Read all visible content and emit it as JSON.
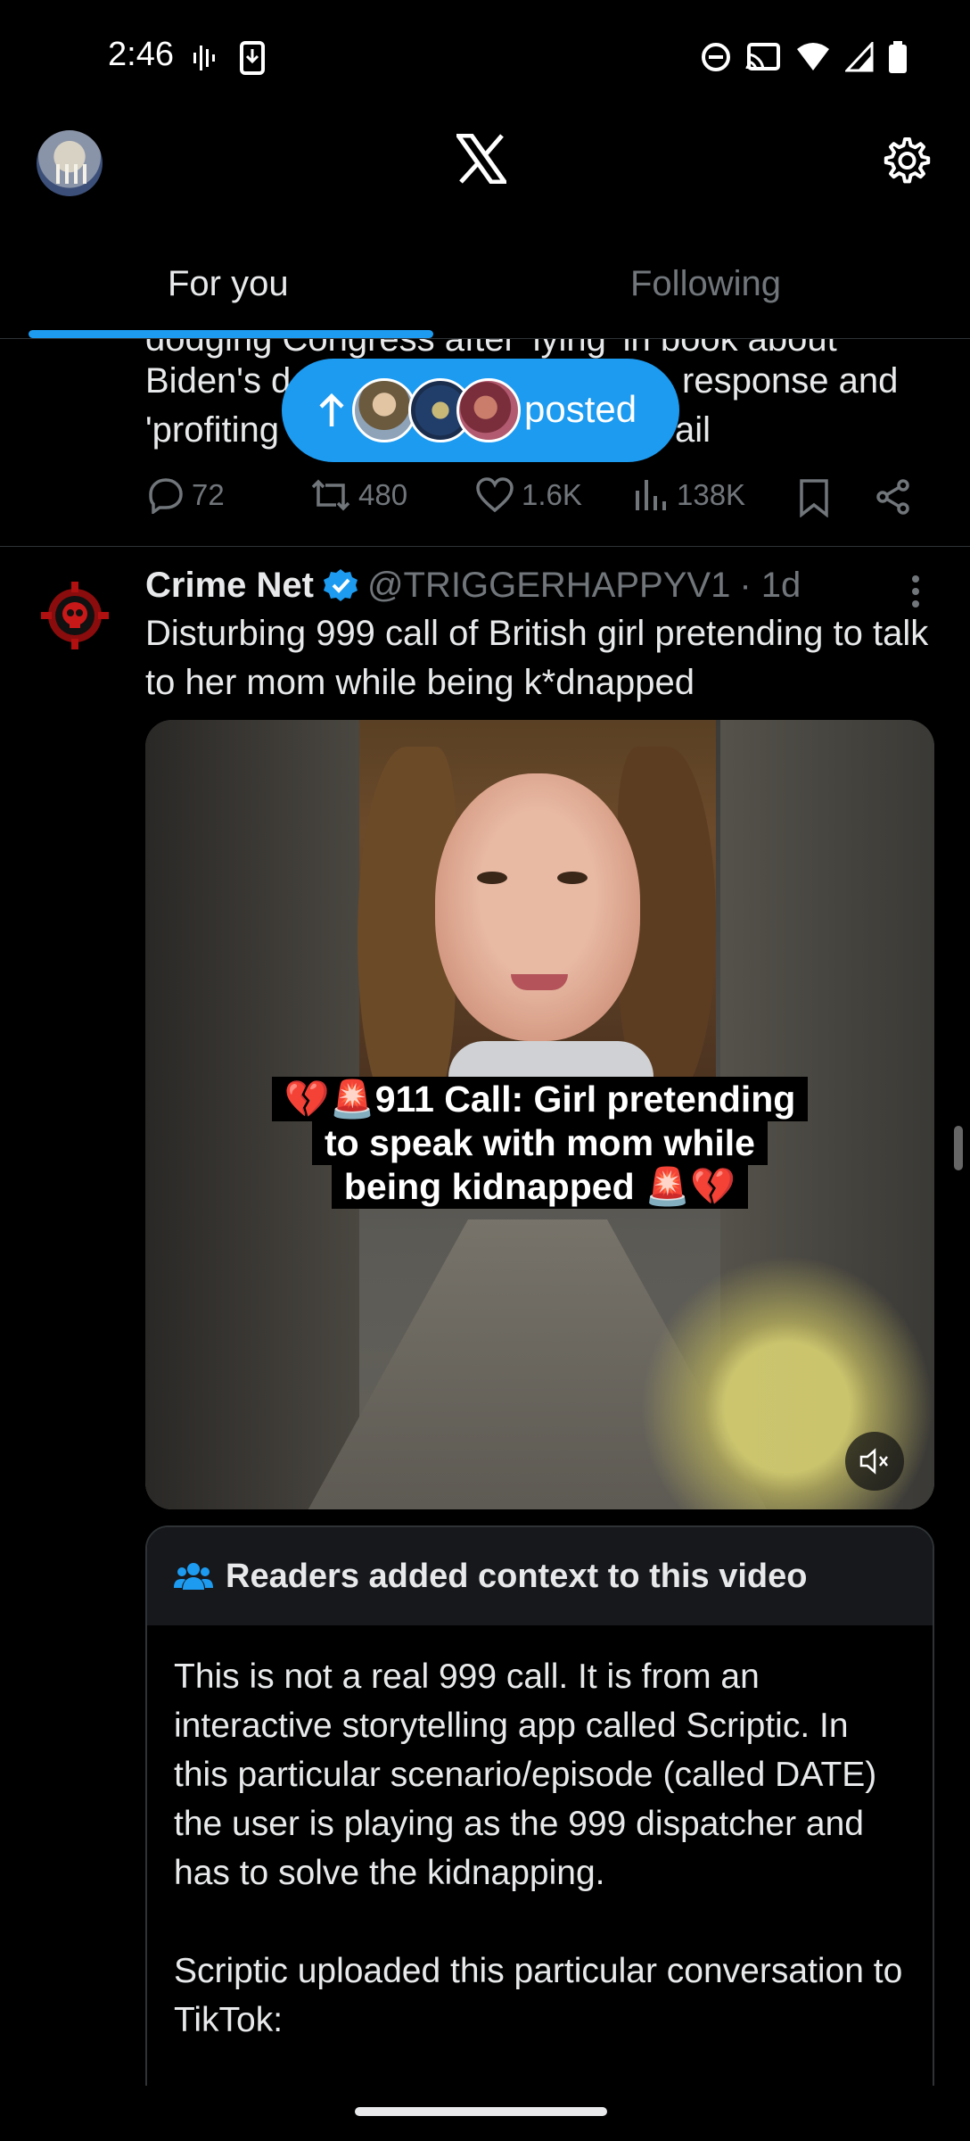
{
  "status_bar": {
    "time": "2:46"
  },
  "header": {
    "logo": "x-logo-icon"
  },
  "tabs": [
    {
      "label": "For you",
      "active": true
    },
    {
      "label": "Following",
      "active": false
    }
  ],
  "previous_tweet": {
    "text_line_1": "dodging Congress after 'lying' in book about",
    "text_line_2_left": "Biden's d",
    "text_line_2_right": "response and",
    "text_line_3_left": "'profiting",
    "text_line_3_right": "ail",
    "replies": "72",
    "reposts": "480",
    "likes": "1.6K",
    "views": "138K"
  },
  "new_posts_pill": {
    "label": "posted"
  },
  "tweet": {
    "name": "Crime Net",
    "handle": "@TRIGGERHAPPYV1",
    "time": "· 1d",
    "text": "Disturbing 999 call of British girl pretending to talk to her mom while being k*dnapped",
    "video_caption_line_1": "💔🚨911 Call: Girl pretending",
    "video_caption_line_2": "to speak with mom while",
    "video_caption_line_3": "being kidnapped 🚨💔"
  },
  "community_note": {
    "title": "Readers added context to this video",
    "paragraph_1": "This is not a real 999 call. It is from an interactive storytelling app called Scriptic. In this particular scenario/episode (called DATE) the user is playing as the 999 dispatcher and has to solve the kidnapping.",
    "paragraph_2": "Scriptic uploaded this particular conversation to TikTok:"
  },
  "colors": {
    "accent": "#1d9bf0",
    "muted": "#71767b",
    "background": "#000000"
  }
}
